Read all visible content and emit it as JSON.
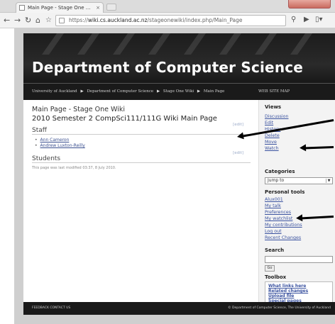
{
  "browser": {
    "tab_title": "Main Page - Stage One ...",
    "tab_close": "×",
    "url_prefix": "https://",
    "url_host": "wiki.cs.auckland.ac.nz",
    "url_path": "/stageonewiki/index.php/Main_Page"
  },
  "header": {
    "site_title": "Department of Computer Science",
    "breadcrumbs": [
      "University of Auckland",
      "Department of Computer Science",
      "Stage One Wiki",
      "Main Page"
    ],
    "breadcrumb_sep": "▶",
    "site_map": "WEB SITE MAP"
  },
  "main": {
    "page_title": "Main Page - Stage One Wiki",
    "heading": "2010 Semester 2 CompSci111/111G Wiki Main Page",
    "edit_label": "[edit]",
    "sections": [
      {
        "title": "Staff",
        "items": [
          "Ann Cameron",
          "Andrew Luxton-Reilly"
        ]
      },
      {
        "title": "Students",
        "items": []
      }
    ],
    "last_modified": "This page was last modified 03:37, 8 July 2010."
  },
  "sidebar": {
    "views_heading": "Views",
    "views": [
      "Discussion",
      "Edit",
      "History",
      "Delete",
      "Move",
      "Watch"
    ],
    "categories_heading": "Categories",
    "categories_selected": "Jump to",
    "personal_heading": "Personal tools",
    "personal": [
      "Alux001",
      "My talk",
      "Preferences",
      "My watchlist",
      "My contributions",
      "Log out",
      "Recent Changes"
    ],
    "search_heading": "Search",
    "go_label": "Go",
    "toolbox_heading": "Toolbox",
    "toolbox": [
      "What links here",
      "Related changes",
      "Upload file",
      "Special pages"
    ]
  },
  "footer": {
    "left": "FEEDBACK  CONTACT US",
    "right": "© Department of Computer Science, The University of Auckland"
  }
}
